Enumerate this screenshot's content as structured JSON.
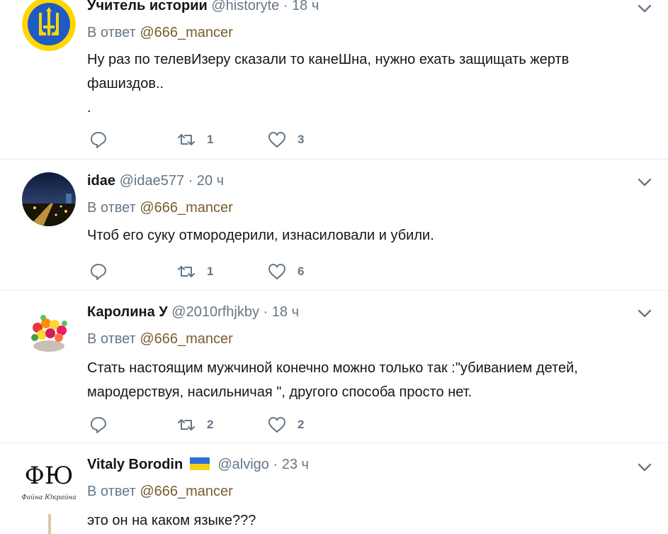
{
  "reply_prefix": "В ответ",
  "tweets": [
    {
      "name": "Учитель истории",
      "handle": "@historyte",
      "separator": "·",
      "time": "18 ч",
      "reply_to": "@666_mancer",
      "text_lines": [
        "Ну раз по телевИзеру сказали то канеШна, нужно ехать защищать жертв",
        "фашиздов..",
        "."
      ],
      "retweets": "1",
      "likes": "3"
    },
    {
      "name": "idae",
      "handle": "@idae577",
      "separator": "·",
      "time": "20 ч",
      "reply_to": "@666_mancer",
      "text_lines": [
        "Чтоб его суку отмородерили, изнасиловали и убили."
      ],
      "retweets": "1",
      "likes": "6"
    },
    {
      "name": "Каролина У",
      "handle": "@2010rfhjkby",
      "separator": "·",
      "time": "18 ч",
      "reply_to": "@666_mancer",
      "text_lines": [
        "Стать настоящим мужчиной конечно можно только так :\"убиванием детей,",
        "мародерствуя, насильничая \", другого способа  просто нет."
      ],
      "retweets": "2",
      "likes": "2"
    },
    {
      "name": "Vitaly Borodin",
      "handle": "@alvigo",
      "separator": "·",
      "time": "23 ч",
      "reply_to": "@666_mancer",
      "text_lines": [
        "это он на каком языке???"
      ],
      "avatar_logo": "ФЮ",
      "avatar_tagline": "Файна Юкрайна"
    }
  ],
  "icons": {
    "reply": "reply-icon",
    "retweet": "retweet-icon",
    "like": "heart-icon",
    "caret": "chevron-down-icon",
    "flag": "ukraine-flag-icon"
  },
  "colors": {
    "text": "#14171a",
    "muted": "#657786",
    "mention": "#7a5c2e",
    "divider": "#e6ecf0",
    "flag_blue": "#2c6fdc",
    "flag_yellow": "#f7d116"
  }
}
